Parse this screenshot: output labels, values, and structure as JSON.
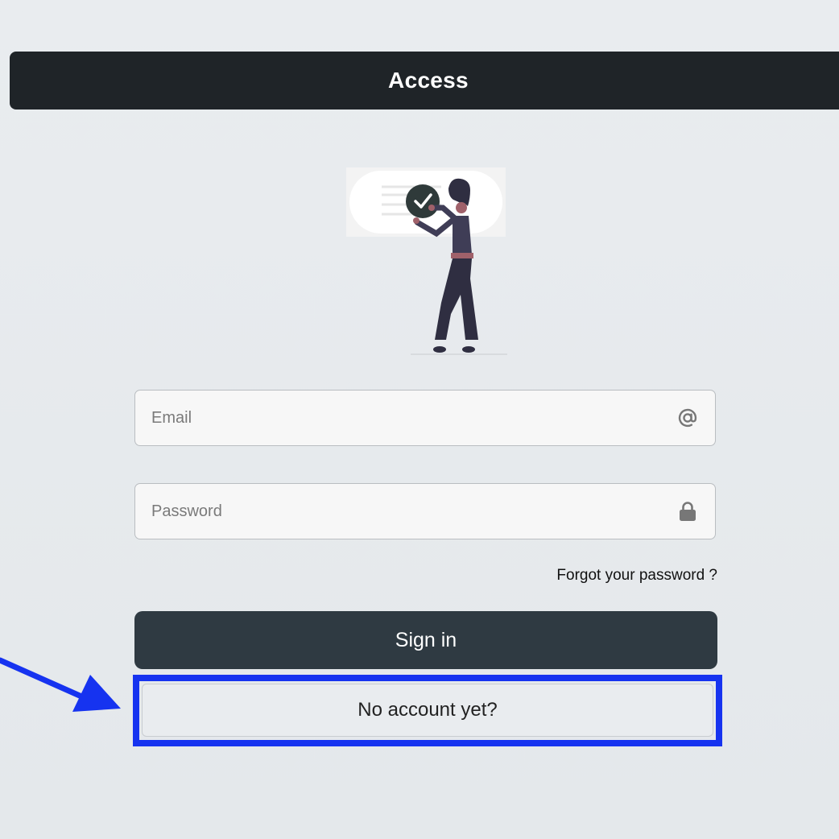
{
  "header": {
    "title": "Access"
  },
  "form": {
    "email": {
      "placeholder": "Email",
      "icon": "at-icon"
    },
    "password": {
      "placeholder": "Password",
      "icon": "lock-icon"
    },
    "forgot_label": "Forgot your password ?",
    "signin_label": "Sign in",
    "no_account_label": "No account yet?"
  },
  "colors": {
    "header_bg": "#1f2428",
    "button_bg": "#2f3a42",
    "highlight": "#1633f0",
    "background": "#e9ecef"
  }
}
